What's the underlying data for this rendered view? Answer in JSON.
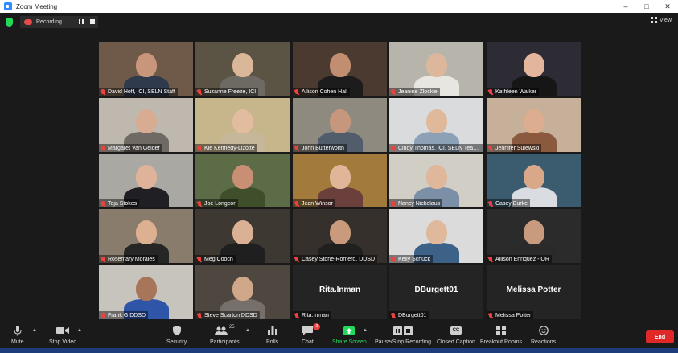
{
  "window": {
    "title": "Zoom Meeting",
    "controls": [
      "–",
      "□",
      "✕"
    ]
  },
  "topbar": {
    "recording_label": "Recording...",
    "view_label": "View"
  },
  "participants": [
    {
      "name": "David Hoff, ICI, SELN Staff",
      "bg": "#6f5a4a",
      "skin": "#c9967b",
      "shirt": "#2f3b4c"
    },
    {
      "name": "Suzanne Freeze, ICI",
      "bg": "#5b5344",
      "skin": "#dbb79a",
      "shirt": "#6d6a64",
      "active": true
    },
    {
      "name": "Allison Cohen Hall",
      "bg": "#4a3a30",
      "skin": "#c28e72",
      "shirt": "#1c1c1c"
    },
    {
      "name": "Jeanine Zlockie",
      "bg": "#b7b4ac",
      "skin": "#dcb79b",
      "shirt": "#e7e6e0"
    },
    {
      "name": "Kathleen Walker",
      "bg": "#2d2b33",
      "skin": "#e3b59d",
      "shirt": "#161616"
    },
    {
      "name": "Margaret Van Gelder",
      "bg": "#bfb8ae",
      "skin": "#d8ab93",
      "shirt": "#6f6a63"
    },
    {
      "name": "Kie Kennedy-Lizotte",
      "bg": "#c7b58c",
      "skin": "#e2bc9f",
      "shirt": "#c6b79b"
    },
    {
      "name": "John Butterworth",
      "bg": "#8e8a7f",
      "skin": "#c6977c",
      "shirt": "#525d6b"
    },
    {
      "name": "Cindy Thomas, ICI, SELN Team (...",
      "bg": "#d9dbdc",
      "skin": "#e0b89a",
      "shirt": "#8ca1b5"
    },
    {
      "name": "Jennifer Sulewski",
      "bg": "#c6b09a",
      "skin": "#dcae8f",
      "shirt": "#8b5a3e"
    },
    {
      "name": "Teja Stokes",
      "bg": "#a9a8a3",
      "skin": "#dfb39a",
      "shirt": "#202024"
    },
    {
      "name": "Joe Longcor",
      "bg": "#5c6c46",
      "skin": "#c98f74",
      "shirt": "#3f4f2c"
    },
    {
      "name": "Jean Winsor",
      "bg": "#a27a3b",
      "skin": "#e0b698",
      "shirt": "#6a3f3c"
    },
    {
      "name": "Nancy Nickolaus",
      "bg": "#d1cec6",
      "skin": "#dfb79b",
      "shirt": "#7b8fa6"
    },
    {
      "name": "Casey Burke",
      "bg": "#3b5b6e",
      "skin": "#d8a889",
      "shirt": "#d9dce0"
    },
    {
      "name": "Rosemary Morales",
      "bg": "#8a7c6c",
      "skin": "#dcb091",
      "shirt": "#262626"
    },
    {
      "name": "Meg Cooch",
      "bg": "#3e3832",
      "skin": "#dbb195",
      "shirt": "#1f1f1f"
    },
    {
      "name": "Casey Stone-Romero, DDSD",
      "bg": "#35302c",
      "skin": "#c99a7c",
      "shirt": "#20201f"
    },
    {
      "name": "Kelly Schuck",
      "bg": "#dadbda",
      "skin": "#e0b89b",
      "shirt": "#3c6387"
    },
    {
      "name": "Allison Enriquez - OR",
      "bg": "#2b2b2b",
      "skin": "#c99b7e",
      "shirt": "#2a2a2a"
    },
    {
      "name": "Frank G DDSD",
      "bg": "#c7c4bd",
      "skin": "#a7755a",
      "shirt": "#2e55a8"
    },
    {
      "name": "Steve Scarton DDSD",
      "bg": "#4e4740",
      "skin": "#d1a78a",
      "shirt": "#77706a"
    },
    {
      "name": "Rita.Inman",
      "display": "Rita.Inman",
      "dark": true
    },
    {
      "name": "DBurgett01",
      "display": "DBurgett01",
      "dark": true
    },
    {
      "name": "Melissa Potter",
      "display": "Melissa Potter",
      "dark": true
    }
  ],
  "toolbar": {
    "mute": "Mute",
    "stop_video": "Stop Video",
    "security": "Security",
    "participants": "Participants",
    "participants_count": "25",
    "polls": "Polls",
    "chat": "Chat",
    "chat_badge": "3",
    "share_screen": "Share Screen",
    "pause_recording": "Pause/Stop Recording",
    "closed_caption": "Closed Caption",
    "closed_caption_icon": "CC",
    "breakout_rooms": "Breakout Rooms",
    "reactions": "Reactions",
    "end": "End"
  }
}
